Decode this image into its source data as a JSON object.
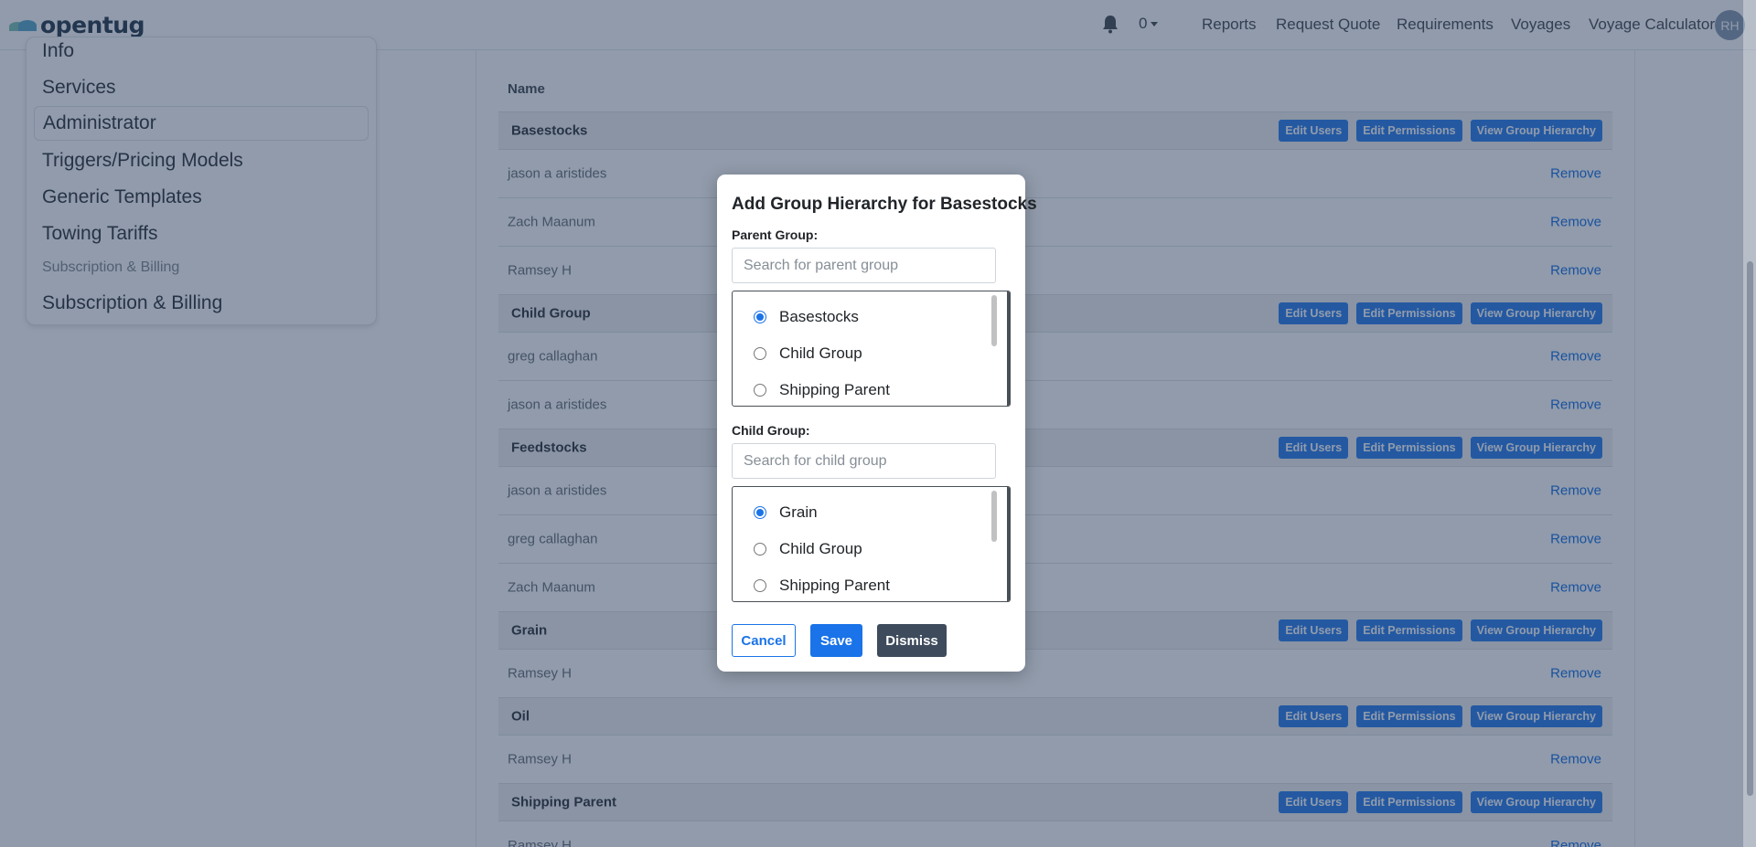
{
  "brand": {
    "name": "opentug"
  },
  "navbar": {
    "notification_count": "0",
    "links": [
      "Reports",
      "Request Quote",
      "Requirements",
      "Voyages",
      "Voyage Calculator"
    ],
    "avatar_initials": "RH"
  },
  "sidebar": {
    "items": [
      "Info",
      "Services",
      "Administrator",
      "Triggers/Pricing Models",
      "Generic Templates",
      "Towing Tariffs"
    ],
    "section_heading": "Subscription & Billing",
    "section_item": "Subscription & Billing",
    "active": "Administrator"
  },
  "table": {
    "header": "Name",
    "edit_users_label": "Edit Users",
    "edit_permissions_label": "Edit Permissions",
    "view_hierarchy_label": "View Group Hierarchy",
    "remove_label": "Remove",
    "groups": [
      {
        "name": "Basestocks",
        "users": [
          "jason a aristides",
          "Zach Maanum",
          "Ramsey H"
        ]
      },
      {
        "name": "Child Group",
        "users": [
          "greg callaghan",
          "jason a aristides"
        ]
      },
      {
        "name": "Feedstocks",
        "users": [
          "jason a aristides",
          "greg callaghan",
          "Zach Maanum"
        ]
      },
      {
        "name": "Grain",
        "users": [
          "Ramsey H"
        ]
      },
      {
        "name": "Oil",
        "users": [
          "Ramsey H"
        ]
      },
      {
        "name": "Shipping Parent",
        "users": [
          "Ramsey H"
        ]
      }
    ]
  },
  "modal": {
    "title": "Add Group Hierarchy for Basestocks",
    "parent_label": "Parent Group:",
    "parent_placeholder": "Search for parent group",
    "parent_options": [
      "Basestocks",
      "Child Group",
      "Shipping Parent"
    ],
    "parent_selected": "Basestocks",
    "child_label": "Child Group:",
    "child_placeholder": "Search for child group",
    "child_options": [
      "Grain",
      "Child Group",
      "Shipping Parent"
    ],
    "child_selected": "Grain",
    "cancel_label": "Cancel",
    "save_label": "Save",
    "dismiss_label": "Dismiss"
  },
  "colors": {
    "accent": "#1a73e8",
    "group_button": "#2f80ed",
    "dismiss_button": "#3d4b5c",
    "overlay": "#192d50"
  }
}
